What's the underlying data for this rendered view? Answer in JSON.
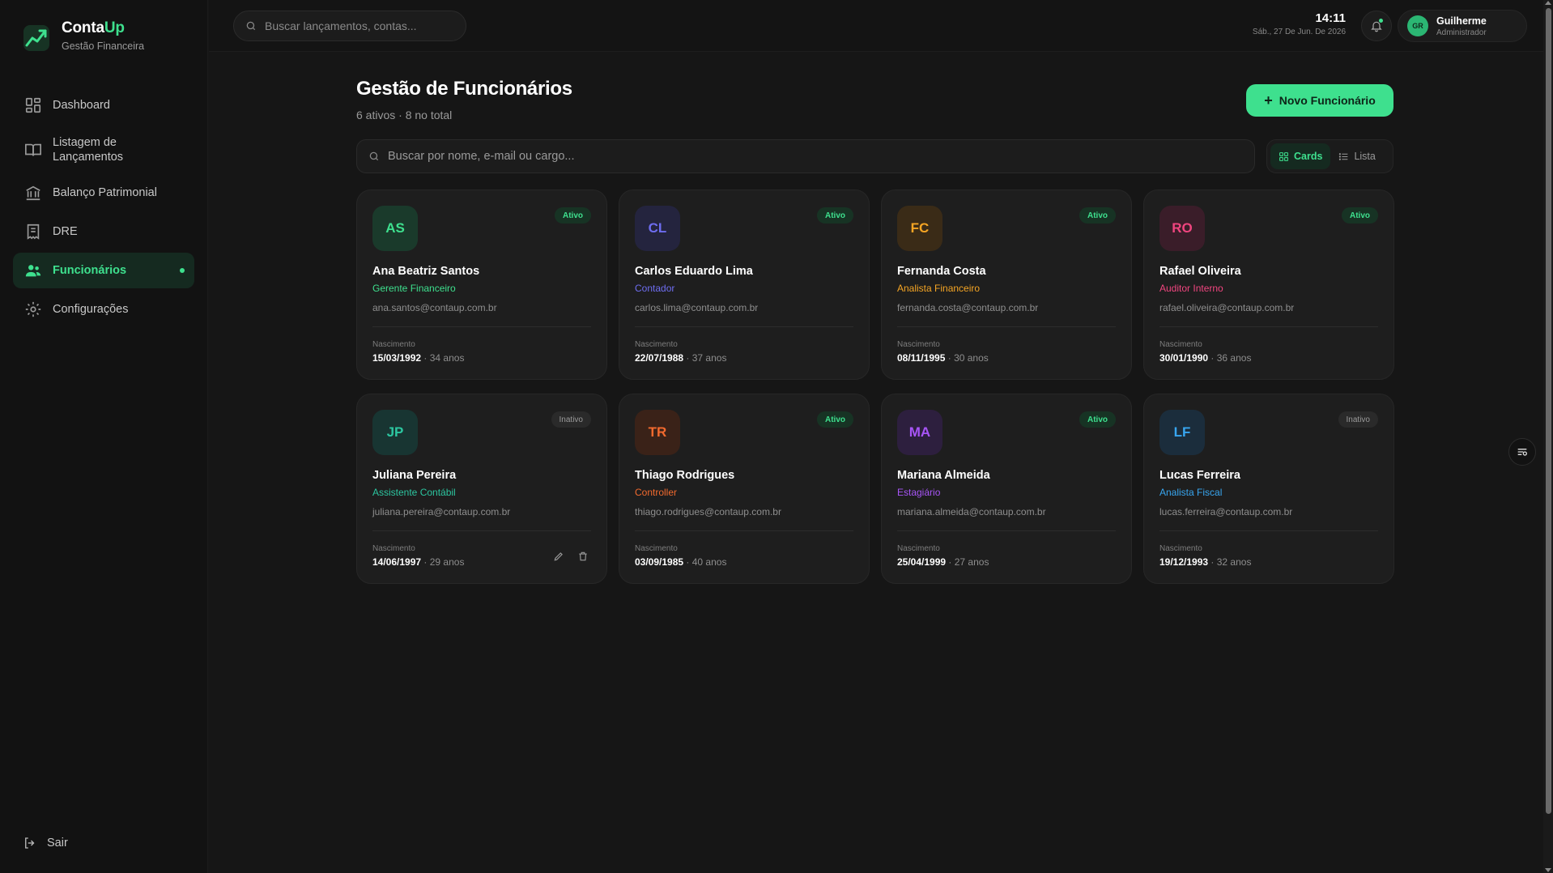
{
  "brand": {
    "name_part1": "Conta",
    "name_part2": "Up",
    "subtitle": "Gestão Financeira",
    "accent_color": "#3ee08e"
  },
  "sidebar": {
    "items": [
      {
        "label": "Dashboard",
        "icon": "dashboard-grid-icon",
        "active": false
      },
      {
        "label": "Listagem de Lançamentos",
        "icon": "book-open-icon",
        "active": false
      },
      {
        "label": "Balanço Patrimonial",
        "icon": "bank-icon",
        "active": false
      },
      {
        "label": "DRE",
        "icon": "receipt-icon",
        "active": false
      },
      {
        "label": "Funcionários",
        "icon": "users-icon",
        "active": true
      },
      {
        "label": "Configurações",
        "icon": "gear-icon",
        "active": false
      }
    ],
    "logout_label": "Sair"
  },
  "topbar": {
    "search_placeholder": "Buscar lançamentos, contas...",
    "time": "14:11",
    "date": "Sáb., 27 De Jun. De 2026",
    "user": {
      "initials": "GR",
      "name": "Guilherme",
      "role": "Administrador"
    }
  },
  "main": {
    "title": "Gestão de Funcionários",
    "subtitle": "6 ativos · 8 no total",
    "new_button_label": "Novo Funcionário",
    "search_placeholder": "Buscar por nome, e-mail ou cargo...",
    "view_toggle": {
      "cards_label": "Cards",
      "list_label": "Lista",
      "selected": "Cards"
    },
    "birth_label": "Nascimento",
    "employees": [
      {
        "initials": "AS",
        "name": "Ana Beatriz Santos",
        "role": "Gerente Financeiro",
        "email": "ana.santos@contaup.com.br",
        "birth": "15/03/1992",
        "age": "34 anos",
        "status": "Ativo",
        "active": true,
        "color": "#3ee08e",
        "bg": "#1a3a2b"
      },
      {
        "initials": "CL",
        "name": "Carlos Eduardo Lima",
        "role": "Contador",
        "email": "carlos.lima@contaup.com.br",
        "birth": "22/07/1988",
        "age": "37 anos",
        "status": "Ativo",
        "active": true,
        "color": "#6e6df0",
        "bg": "#24243e"
      },
      {
        "initials": "FC",
        "name": "Fernanda Costa",
        "role": "Analista Financeiro",
        "email": "fernanda.costa@contaup.com.br",
        "birth": "08/11/1995",
        "age": "30 anos",
        "status": "Ativo",
        "active": true,
        "color": "#f5a524",
        "bg": "#3a2b17"
      },
      {
        "initials": "RO",
        "name": "Rafael Oliveira",
        "role": "Auditor Interno",
        "email": "rafael.oliveira@contaup.com.br",
        "birth": "30/01/1990",
        "age": "36 anos",
        "status": "Ativo",
        "active": true,
        "color": "#f0457f",
        "bg": "#3a1d29"
      },
      {
        "initials": "JP",
        "name": "Juliana Pereira",
        "role": "Assistente Contábil",
        "email": "juliana.pereira@contaup.com.br",
        "birth": "14/06/1997",
        "age": "29 anos",
        "status": "Inativo",
        "active": false,
        "color": "#2cc6a0",
        "bg": "#183532"
      },
      {
        "initials": "TR",
        "name": "Thiago Rodrigues",
        "role": "Controller",
        "email": "thiago.rodrigues@contaup.com.br",
        "birth": "03/09/1985",
        "age": "40 anos",
        "status": "Ativo",
        "active": true,
        "color": "#f26a2e",
        "bg": "#3a2218"
      },
      {
        "initials": "MA",
        "name": "Mariana Almeida",
        "role": "Estagiário",
        "email": "mariana.almeida@contaup.com.br",
        "birth": "25/04/1999",
        "age": "27 anos",
        "status": "Ativo",
        "active": true,
        "color": "#a855f7",
        "bg": "#2d1f3e"
      },
      {
        "initials": "LF",
        "name": "Lucas Ferreira",
        "role": "Analista Fiscal",
        "email": "lucas.ferreira@contaup.com.br",
        "birth": "19/12/1993",
        "age": "32 anos",
        "status": "Inativo",
        "active": false,
        "color": "#38a6f0",
        "bg": "#1b2d3c"
      }
    ]
  }
}
